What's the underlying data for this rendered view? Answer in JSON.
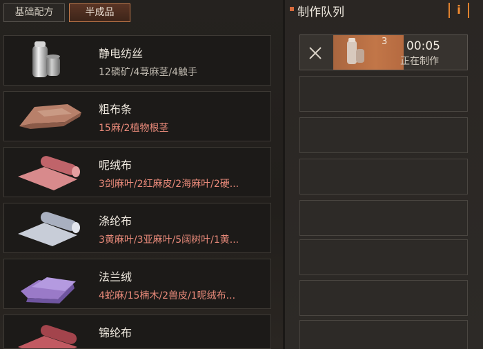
{
  "tabs": [
    "基础配方",
    "半成品"
  ],
  "recipes": [
    {
      "name": "静电纺丝",
      "materials": "12磷矿/4荨麻茎/4触手",
      "status": "ok",
      "icon": "spool-icon"
    },
    {
      "name": "粗布条",
      "materials": "15麻/2植物根茎",
      "status": "bad",
      "icon": "cloth-strip-icon"
    },
    {
      "name": "呢绒布",
      "materials": "3剑麻叶/2红麻皮/2海麻叶/2硬...",
      "status": "bad",
      "icon": "wool-cloth-icon"
    },
    {
      "name": "涤纶布",
      "materials": "3黄麻叶/3亚麻叶/5阔树叶/1黄...",
      "status": "bad",
      "icon": "polyester-cloth-icon"
    },
    {
      "name": "法兰绒",
      "materials": "4蛇麻/15楠木/2兽皮/1呢绒布...",
      "status": "bad",
      "icon": "flannel-icon"
    },
    {
      "name": "锦纶布",
      "materials": "",
      "status": "bad",
      "icon": "nylon-cloth-icon"
    }
  ],
  "queue": {
    "title": "制作队列",
    "info_label": "i",
    "active": {
      "quantity": "3",
      "time": "00:05",
      "status": "正在制作",
      "icon": "spool-icon"
    }
  },
  "colors": {
    "accent": "#e0822f",
    "materials_missing": "#e98a7a",
    "materials_ok": "#bdb7ad"
  }
}
